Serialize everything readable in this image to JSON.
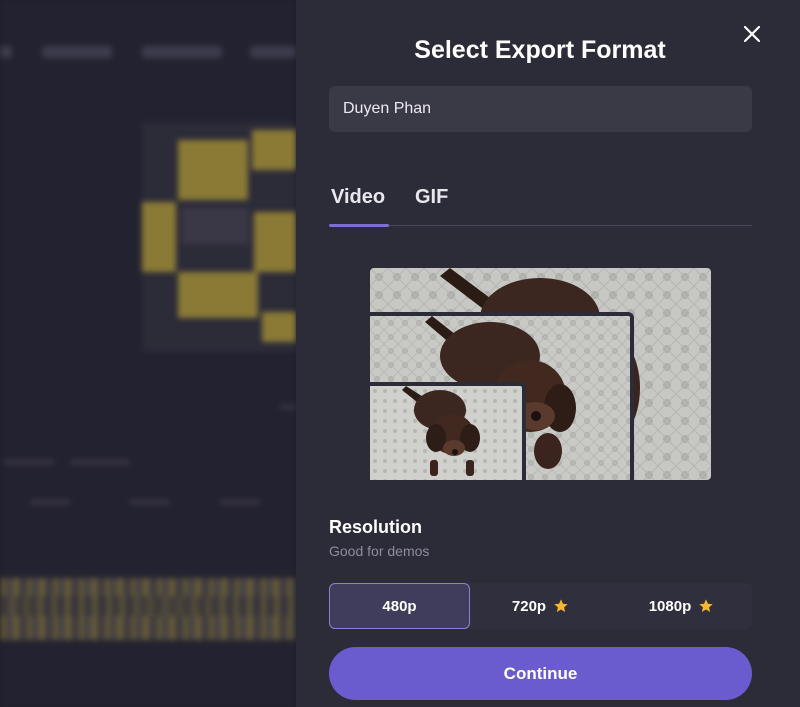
{
  "dialog": {
    "title": "Select Export Format",
    "close_icon": "close-icon",
    "name_field_value": "Duyen Phan"
  },
  "tabs": [
    {
      "label": "Video",
      "active": true
    },
    {
      "label": "GIF",
      "active": false
    }
  ],
  "resolution": {
    "title": "Resolution",
    "subtitle": "Good for demos",
    "options": [
      {
        "label": "480p",
        "selected": true,
        "premium": false
      },
      {
        "label": "720p",
        "selected": false,
        "premium": true,
        "icon": "star-icon"
      },
      {
        "label": "1080p",
        "selected": false,
        "premium": true,
        "icon": "star-icon"
      }
    ]
  },
  "continue_label": "Continue",
  "colors": {
    "panel_bg": "#2c2b38",
    "accent": "#6a5ccf",
    "star": "#f5b82e"
  }
}
